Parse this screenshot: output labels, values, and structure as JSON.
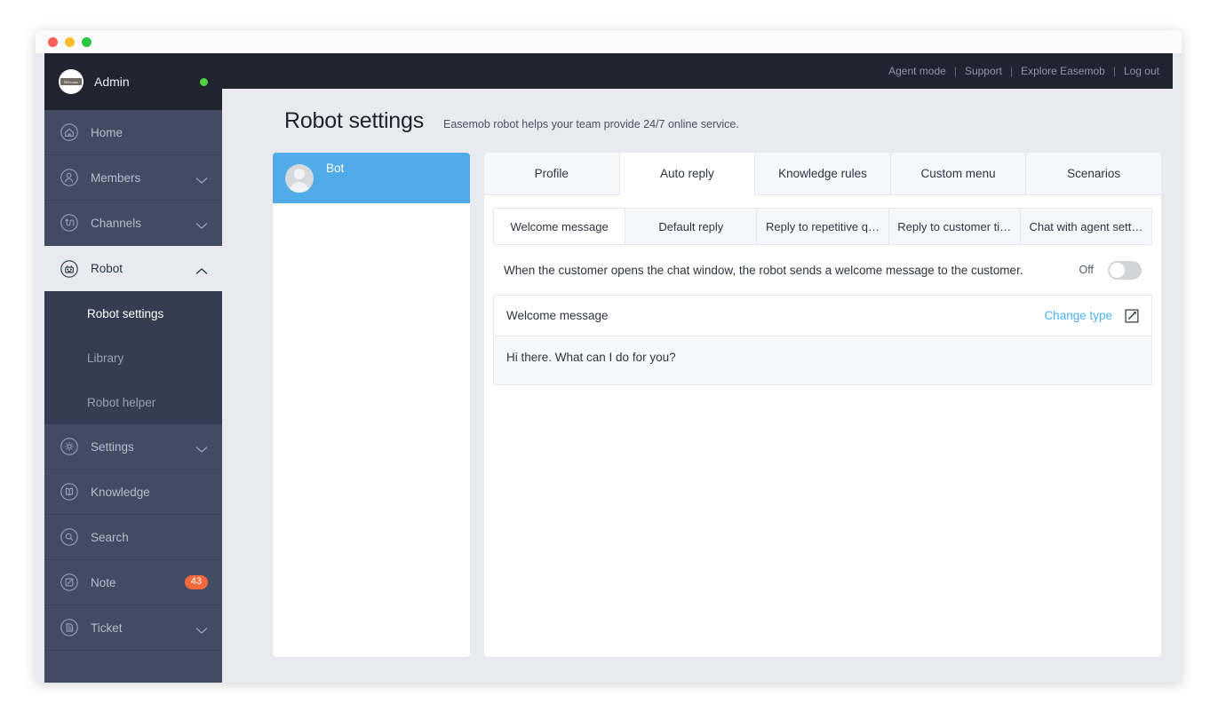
{
  "window": {
    "traffic_lights": [
      "close",
      "minimize",
      "zoom"
    ]
  },
  "topbar": {
    "links": [
      {
        "label": "Agent mode",
        "name": "agent-mode-link"
      },
      {
        "label": "Support",
        "name": "support-link"
      },
      {
        "label": "Explore Easemob",
        "name": "explore-easemob-link"
      },
      {
        "label": "Log out",
        "name": "log-out-link"
      }
    ],
    "divider": "|"
  },
  "sidebar": {
    "account": {
      "name": "Admin",
      "avatar_text": "Welcome",
      "status": "online",
      "status_color": "#52d13f"
    },
    "items": [
      {
        "label": "Home",
        "icon": "home-icon",
        "expandable": false,
        "active": false
      },
      {
        "label": "Members",
        "icon": "members-icon",
        "expandable": true,
        "active": false
      },
      {
        "label": "Channels",
        "icon": "channels-icon",
        "expandable": true,
        "active": false
      },
      {
        "label": "Robot",
        "icon": "robot-icon",
        "expandable": true,
        "active": true
      },
      {
        "label": "Settings",
        "icon": "gear-icon",
        "expandable": true,
        "active": false
      },
      {
        "label": "Knowledge",
        "icon": "book-icon",
        "expandable": false,
        "active": false
      },
      {
        "label": "Search",
        "icon": "search-icon",
        "expandable": false,
        "active": false
      },
      {
        "label": "Note",
        "icon": "note-icon",
        "expandable": false,
        "active": false,
        "badge": "43"
      },
      {
        "label": "Ticket",
        "icon": "ticket-icon",
        "expandable": true,
        "active": false
      }
    ],
    "robot_submenu": [
      {
        "label": "Robot settings",
        "active": true
      },
      {
        "label": "Library",
        "active": false
      },
      {
        "label": "Robot helper",
        "active": false
      }
    ],
    "badge_color": "#f2693c"
  },
  "page": {
    "title": "Robot settings",
    "subtitle": "Easemob robot helps your team provide 24/7 online service."
  },
  "bot_list": {
    "items": [
      {
        "name": "Bot",
        "selected": true
      }
    ],
    "selected_color": "#50abe6"
  },
  "main": {
    "tabs": [
      {
        "label": "Profile",
        "active": false
      },
      {
        "label": "Auto reply",
        "active": true
      },
      {
        "label": "Knowledge rules",
        "active": false
      },
      {
        "label": "Custom menu",
        "active": false
      },
      {
        "label": "Scenarios",
        "active": false
      }
    ],
    "subtabs": [
      {
        "label": "Welcome message",
        "active": true
      },
      {
        "label": "Default reply",
        "active": false
      },
      {
        "label": "Reply to repetitive q…",
        "active": false
      },
      {
        "label": "Reply to customer ti…",
        "active": false
      },
      {
        "label": "Chat with agent sett…",
        "active": false
      }
    ],
    "toggle_row": {
      "description": "When the customer opens the chat window, the robot sends a welcome message to the customer.",
      "state_label": "Off",
      "checked": false
    },
    "message_card": {
      "title": "Welcome message",
      "change_type_label": "Change type",
      "edit_icon": "edit-icon",
      "body": "Hi there. What can I do for you?"
    }
  }
}
